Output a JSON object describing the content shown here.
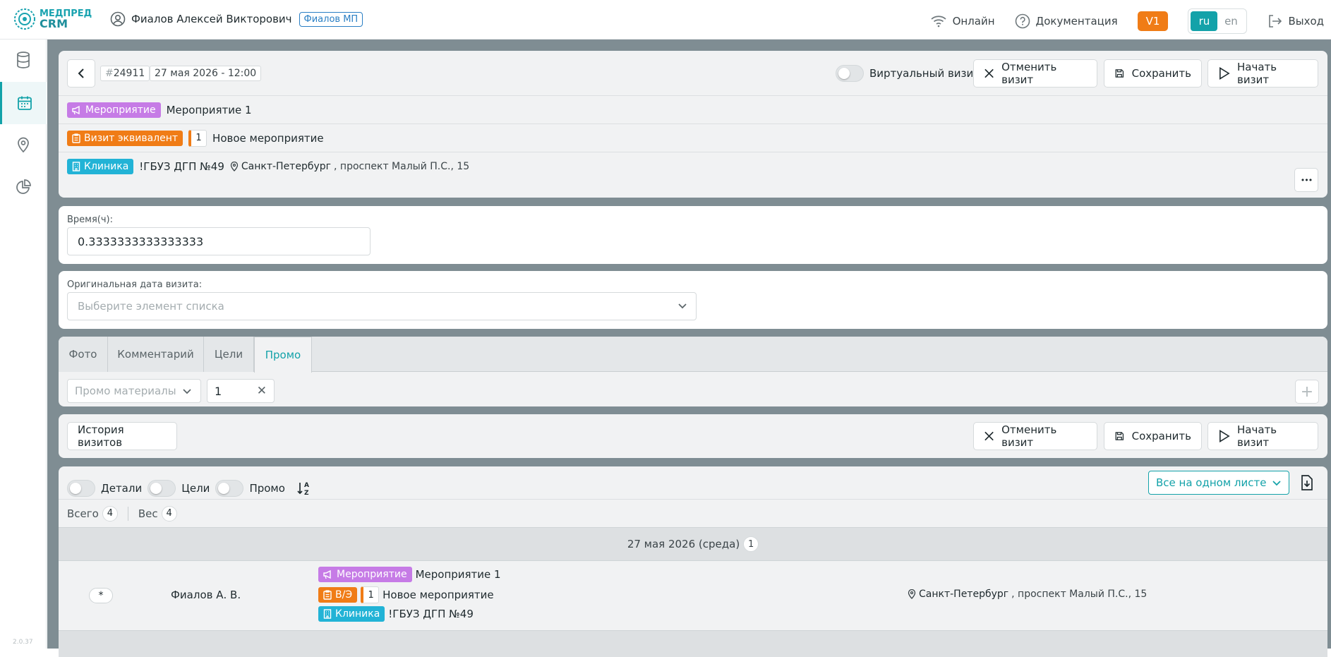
{
  "header": {
    "logo_line1": "МЕДПРЕД",
    "logo_line2": "CRM",
    "user_name": "Фиалов Алексей Викторович",
    "user_role": "Фиалов МП",
    "online": "Онлайн",
    "docs": "Документация",
    "version": "V1",
    "lang_ru": "ru",
    "lang_en": "en",
    "logout": "Выход"
  },
  "sidebar": {
    "version": "2.0.37"
  },
  "visit": {
    "id_hash": "#",
    "id": "24911",
    "datetime": "27 мая 2026 - 12:00",
    "virtual_label": "Виртуальный визит",
    "cancel": "Отменить визит",
    "save": "Сохранить",
    "start": "Начать визит",
    "event_chip": "Мероприятие",
    "event_name": "Мероприятие 1",
    "equiv_chip": "Визит эквивалент",
    "equiv_num": "1",
    "equiv_name": "Новое мероприятие",
    "clinic_chip": "Клиника",
    "clinic_name": "!ГБУЗ ДГП №49",
    "city": "Санкт-Петербург",
    "address": ", проспект Малый П.С., 15",
    "more": "•••"
  },
  "time": {
    "label": "Время(ч):",
    "value": "0.3333333333333333"
  },
  "orig_date": {
    "label": "Оригинальная дата визита:",
    "placeholder": "Выберите элемент списка"
  },
  "tabs": [
    {
      "label": "Фото"
    },
    {
      "label": "Комментарий"
    },
    {
      "label": "Цели"
    },
    {
      "label": "Промо"
    }
  ],
  "promo": {
    "placeholder": "Промо материалы",
    "qty": "1",
    "clear": "✕",
    "add": "+"
  },
  "actions": {
    "history": "История визитов",
    "cancel": "Отменить визит",
    "save": "Сохранить",
    "start": "Начать визит"
  },
  "list": {
    "toggle_details": "Детали",
    "toggle_goals": "Цели",
    "toggle_promo": "Промо",
    "view_select": "Все на одном листе",
    "total_label": "Всего",
    "total_count": "4",
    "weight_label": "Вес",
    "weight_count": "4",
    "date_group": "27 мая 2026 (среда)",
    "date_group_count": "1",
    "row": {
      "marker": "*",
      "person": "Фиалов А. В.",
      "event_chip": "Мероприятие",
      "event_name": "Мероприятие 1",
      "ve_chip": "В/Э",
      "ve_num": "1",
      "ve_name": "Новое мероприятие",
      "clinic_chip": "Клиника",
      "clinic_name": "!ГБУЗ ДГП №49",
      "city": "Санкт-Петербург",
      "address": ", проспект Малый П.С., 15"
    }
  },
  "colors": {
    "accent": "#13a2a9",
    "orange": "#f07c16",
    "purple": "#c67be6",
    "blue": "#22b3d6"
  }
}
